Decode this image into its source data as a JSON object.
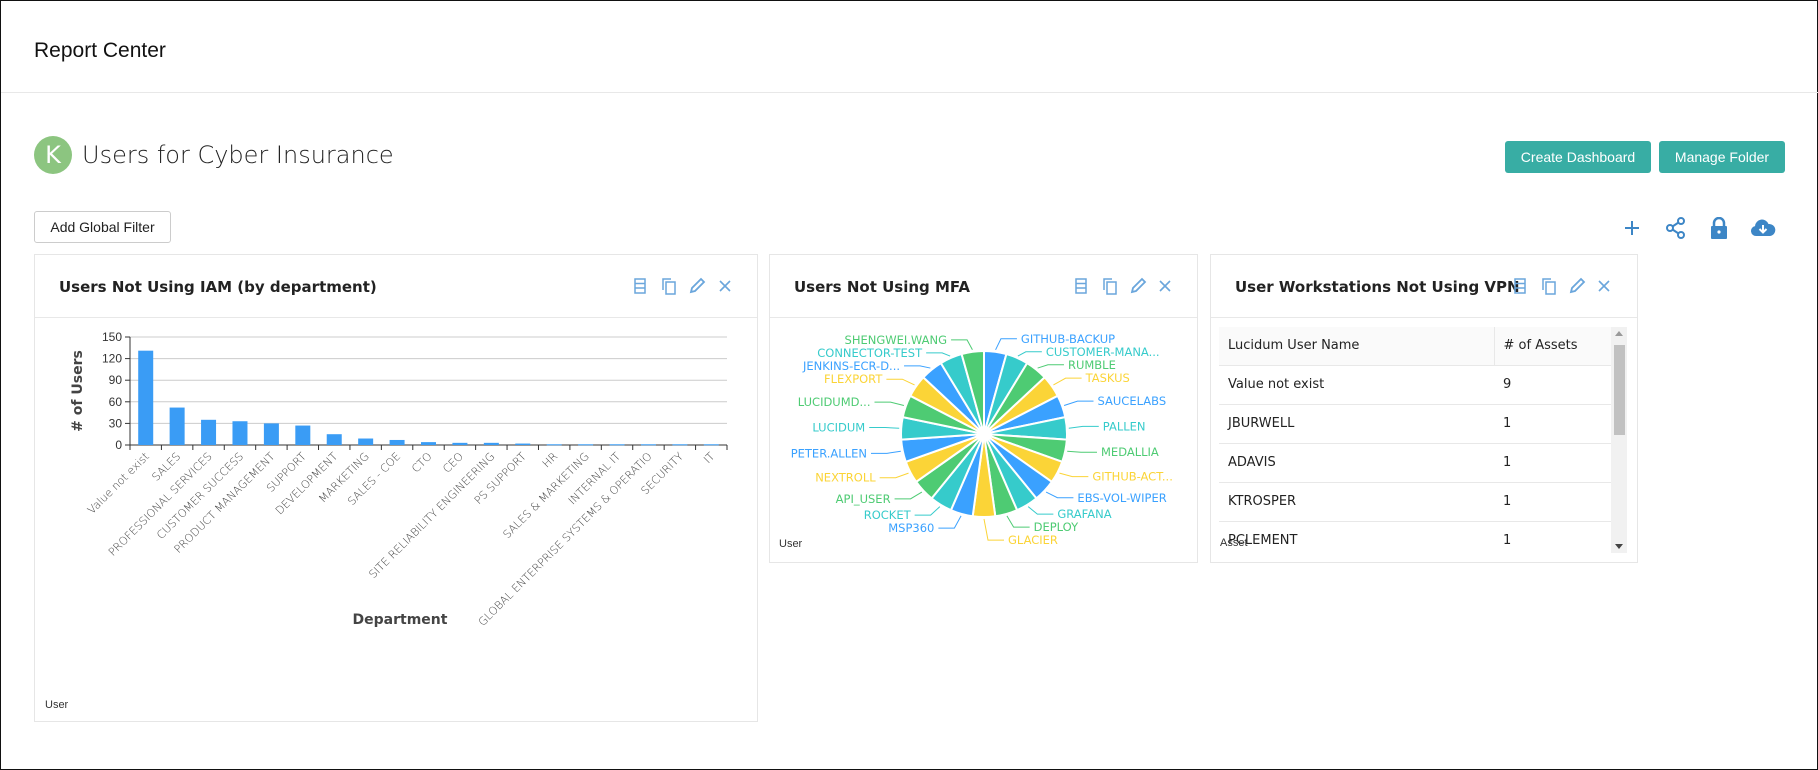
{
  "header": {
    "title": "Report Center"
  },
  "folder": {
    "avatar_letter": "K",
    "title": "Users for Cyber Insurance",
    "avatar_color": "#8cc580"
  },
  "buttons": {
    "create_dashboard": "Create Dashboard",
    "manage_folder": "Manage Folder",
    "add_global_filter": "Add Global Filter"
  },
  "toolbar_icons": [
    "plus-icon",
    "share-icon",
    "lock-icon",
    "cloud-download-icon"
  ],
  "accent_color": "#38ada4",
  "panels": [
    {
      "title": "Users Not Using IAM (by department)",
      "footer": "User"
    },
    {
      "title": "Users Not Using MFA",
      "footer": "User"
    },
    {
      "title": "User Workstations Not Using VPN",
      "footer": "Asset"
    }
  ],
  "chart_data": [
    {
      "type": "bar",
      "title": "",
      "xlabel": "Department",
      "ylabel": "# of Users",
      "ylim": [
        0,
        150
      ],
      "yticks": [
        0,
        30,
        60,
        90,
        120,
        150
      ],
      "grid": true,
      "color": "#3a9cf5",
      "categories": [
        "Value not exist",
        "SALES",
        "PROFESSIONAL SERVICES",
        "CUSTOMER SUCCESS",
        "PRODUCT MANAGEMENT",
        "SUPPORT",
        "DEVELOPMENT",
        "MARKETING",
        "SALES - COE",
        "CTO",
        "CEO",
        "SITE RELIABILITY ENGINEERING",
        "PS SUPPORT",
        "HR",
        "SALES & MARKETING",
        "INTERNAL IT",
        "GLOBAL ENTERPRISE SYSTEMS & OPERATIO",
        "SECURITY",
        "IT"
      ],
      "values": [
        131,
        52,
        35,
        33,
        30,
        27,
        15,
        9,
        7,
        4,
        3,
        3,
        2,
        1,
        1,
        1,
        1,
        1,
        1
      ]
    },
    {
      "type": "pie",
      "title": "",
      "colors": [
        "#3aa1ff",
        "#36cbcb",
        "#4ecb73",
        "#fbd437"
      ],
      "categories": [
        "GITHUB-BACKUP",
        "CUSTOMER-MANA...",
        "RUMBLE",
        "TASKUS",
        "SAUCELABS",
        "PALLEN",
        "MEDALLIA",
        "GITHUB-ACT...",
        "EBS-VOL-WIPER",
        "GRAFANA",
        "DEPLOY",
        "GLACIER",
        "MSP360",
        "ROCKET",
        "API_USER",
        "NEXTROLL",
        "PETER.ALLEN",
        "LUCIDUM",
        "LUCIDUMD...",
        "FLEXPORT",
        "JENKINS-ECR-D...",
        "CONNECTOR-TEST",
        "SHENGWEI.WANG"
      ],
      "values": [
        1,
        1,
        1,
        1,
        1,
        1,
        1,
        1,
        1,
        1,
        1,
        1,
        1,
        1,
        1,
        1,
        1,
        1,
        1,
        1,
        1,
        1,
        1
      ]
    },
    {
      "type": "table",
      "columns": [
        "Lucidum User Name",
        "# of Assets"
      ],
      "rows": [
        [
          "Value not exist",
          "9"
        ],
        [
          "JBURWELL",
          "1"
        ],
        [
          "ADAVIS",
          "1"
        ],
        [
          "KTROSPER",
          "1"
        ],
        [
          "PCLEMENT",
          "1"
        ]
      ]
    }
  ]
}
